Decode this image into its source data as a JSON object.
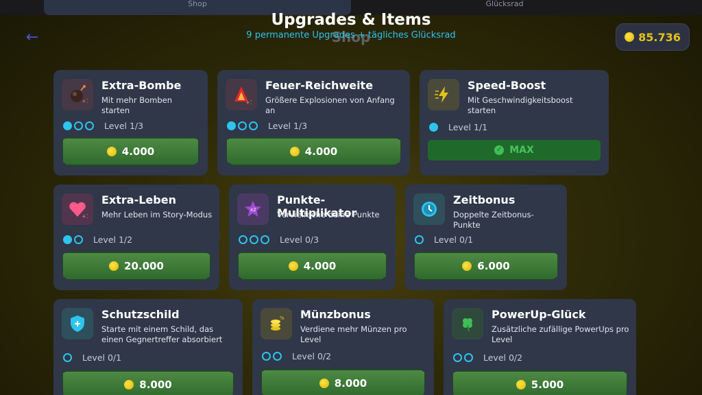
{
  "tabs": {
    "shop": "Shop",
    "wheel": "Glücksrad"
  },
  "header": {
    "title": "Upgrades & Items",
    "subtitle": "9 permanente Upgrades + tägliches Glücksrad",
    "ghost": "Shop",
    "back_icon": "arrow-left-icon"
  },
  "coins": {
    "value": "85.736",
    "color": "#e3c21a"
  },
  "accent": "#2dc4ee",
  "cards": [
    {
      "title": "Extra-Bombe",
      "desc": "Mit mehr Bomben starten",
      "level": "Level 1/3",
      "filled": 1,
      "total": 3,
      "price": "4.000",
      "icon": "bomb-icon"
    },
    {
      "title": "Feuer-Reichweite",
      "desc": "Größere Explosionen von Anfang an",
      "level": "Level 1/3",
      "filled": 1,
      "total": 3,
      "price": "4.000",
      "icon": "fire-icon"
    },
    {
      "title": "Speed-Boost",
      "desc": "Mit Geschwindigkeitsboost starten",
      "level": "Level 1/1",
      "filled": 1,
      "total": 1,
      "max": "MAX",
      "icon": "lightning-icon"
    },
    {
      "title": "Extra-Leben",
      "desc": "Mehr Leben im Story-Modus",
      "level": "Level 1/2",
      "filled": 1,
      "total": 2,
      "price": "20.000",
      "icon": "heart-icon"
    },
    {
      "title": "Punkte-Multiplikator",
      "desc": "Vervielfache deine Punkte",
      "level": "Level 0/3",
      "filled": 0,
      "total": 3,
      "price": "4.000",
      "icon": "star-icon"
    },
    {
      "title": "Zeitbonus",
      "desc": "Doppelte Zeitbonus-Punkte",
      "level": "Level 0/1",
      "filled": 0,
      "total": 1,
      "price": "6.000",
      "icon": "clock-icon"
    },
    {
      "title": "Schutzschild",
      "desc": "Starte mit einem Schild, das einen Gegnertreffer absorbiert",
      "level": "Level 0/1",
      "filled": 0,
      "total": 1,
      "price": "8.000",
      "icon": "shield-icon"
    },
    {
      "title": "Münzbonus",
      "desc": "Verdiene mehr Münzen pro Level",
      "level": "Level 0/2",
      "filled": 0,
      "total": 2,
      "price": "8.000",
      "icon": "coins-icon"
    },
    {
      "title": "PowerUp-Glück",
      "desc": "Zusätzliche zufällige PowerUps pro Level",
      "level": "Level 0/2",
      "filled": 0,
      "total": 2,
      "price": "5.000",
      "icon": "clover-icon"
    }
  ]
}
